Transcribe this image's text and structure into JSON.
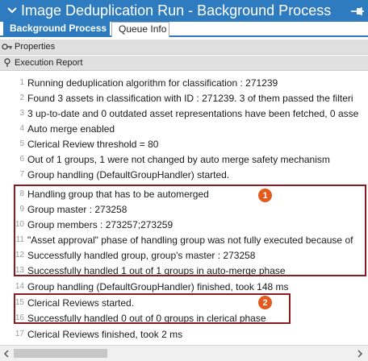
{
  "window": {
    "title": "Image Deduplication Run - Background Process"
  },
  "tabs": [
    {
      "label": "Background Process"
    },
    {
      "label": "Queue Info"
    }
  ],
  "sections": {
    "properties": "Properties",
    "execution_report": "Execution Report"
  },
  "report_lines": [
    {
      "num": "1",
      "text": "Running deduplication algorithm for classification : 271239"
    },
    {
      "num": "2",
      "text": "Found 3 assets in classification with ID : 271239. 3 of them passed the filteri"
    },
    {
      "num": "3",
      "text": "3 up-to-date and 0 outdated asset representations have been fetched, 0 asse"
    },
    {
      "num": "4",
      "text": "Auto merge enabled"
    },
    {
      "num": "5",
      "text": "Clerical Review threshold = 80"
    },
    {
      "num": "6",
      "text": "Out of 1 groups, 1 were not changed by auto merge safety mechanism"
    },
    {
      "num": "7",
      "text": "Group handling (DefaultGroupHandler) started."
    },
    {
      "num": "8",
      "text": "Handling group that has to be automerged"
    },
    {
      "num": "9",
      "text": "Group master : 273258"
    },
    {
      "num": "10",
      "text": "Group members : 273257;273259"
    },
    {
      "num": "11",
      "text": "\"Asset approval\" phase of handling group was not fully executed because of"
    },
    {
      "num": "12",
      "text": "Successfully handled group, group's master : 273258"
    },
    {
      "num": "13",
      "text": "Successfully handled 1 out of 1 groups in auto-merge phase"
    },
    {
      "num": "14",
      "text": "Group handling (DefaultGroupHandler) finished, took 148 ms"
    },
    {
      "num": "15",
      "text": "Clerical Reviews started."
    },
    {
      "num": "16",
      "text": "Successfully handled 0 out of 0 groups in clerical phase"
    },
    {
      "num": "17",
      "text": "Clerical Reviews finished, took 2 ms"
    }
  ],
  "annotations": [
    {
      "label": "1",
      "color": "#e25a1c"
    },
    {
      "label": "2",
      "color": "#e25a1c"
    }
  ],
  "colors": {
    "accent": "#2e7bc0",
    "highlight_border": "#8b1a22"
  }
}
